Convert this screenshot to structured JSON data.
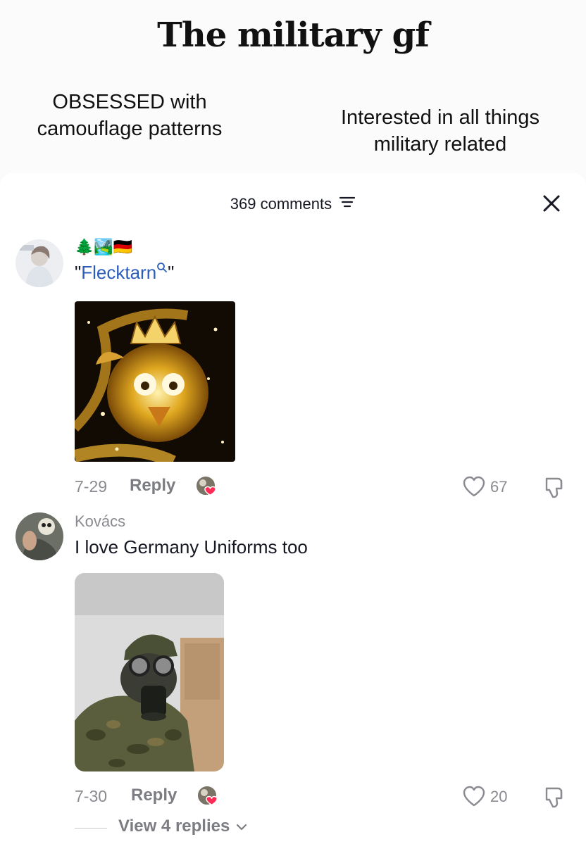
{
  "video": {
    "title": "The military gf",
    "caption_left": "OBSESSED with camouflage patterns",
    "caption_right": "Interested in all things military related"
  },
  "comments_header": {
    "count_label": "369 comments",
    "filter_icon": "sort-filter-icon",
    "close_icon": "close-icon"
  },
  "comments": [
    {
      "username": "🌲🏞️🇩🇪",
      "text_prefix": "\"",
      "hashtag": "Flecktarn",
      "text_suffix": "\"",
      "image": "golden-jeweled-bird-with-crown-sticker",
      "date": "7-29",
      "reply_label": "Reply",
      "likes": "67"
    },
    {
      "username": "Kovács",
      "text": "I love Germany Uniforms too",
      "image": "person-in-camouflage-uniform-and-gas-mask-photo",
      "date": "7-30",
      "reply_label": "Reply",
      "likes": "20"
    }
  ],
  "view_replies": {
    "label": "View 4 replies"
  },
  "colors": {
    "hashtag": "#2b5db9",
    "secondary_text": "#8a8b91",
    "creator_heart": "#fe2c55"
  }
}
